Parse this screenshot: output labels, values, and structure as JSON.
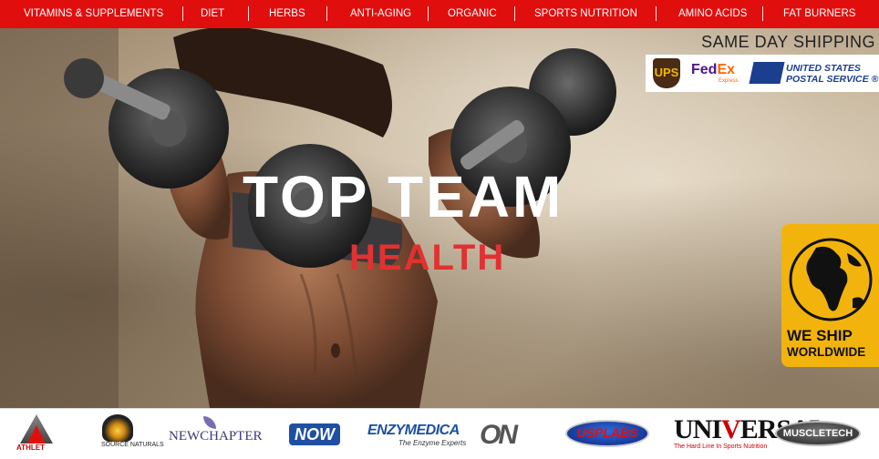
{
  "nav": {
    "items": [
      {
        "label": "VITAMINS & SUPPLEMENTS"
      },
      {
        "label": "DIET"
      },
      {
        "label": "HERBS"
      },
      {
        "label": "ANTI-AGING"
      },
      {
        "label": "ORGANIC"
      },
      {
        "label": "SPORTS NUTRITION"
      },
      {
        "label": "AMINO ACIDS"
      },
      {
        "label": "FAT BURNERS"
      }
    ],
    "background_color": "#e10e0e"
  },
  "hero": {
    "title": "TOP TEAM",
    "subtitle": "HEALTH",
    "subtitle_color": "#e23131",
    "shipping": {
      "headline": "SAME DAY SHIPPING",
      "carriers": {
        "ups": "UPS",
        "fedex_fed": "Fed",
        "fedex_ex": "Ex",
        "fedex_sub": "Express",
        "usps_line1": "UNITED STATES",
        "usps_line2": "POSTAL SERVICE ®"
      }
    },
    "badge": {
      "line1": "WE SHIP",
      "line2": "WORLDWIDE",
      "icon": "globe-icon",
      "color": "#f2b40c"
    }
  },
  "brands": {
    "athlet": "ATHLET",
    "source_naturals": "SOURCE NATURALS",
    "newchapter": "NEWCHAPTER",
    "now": "NOW",
    "enzymedica": "ENZYMEDICA",
    "enzymedica_tagline": "The Enzyme Experts",
    "on": "ON",
    "usplabs": "USPLABS",
    "universal_pre": "UNI",
    "universal_mid": "V",
    "universal_post": "ERSAL",
    "universal_tagline": "The Hard Line In Sports Nutrition",
    "muscletech": "MUSCLETECH"
  }
}
